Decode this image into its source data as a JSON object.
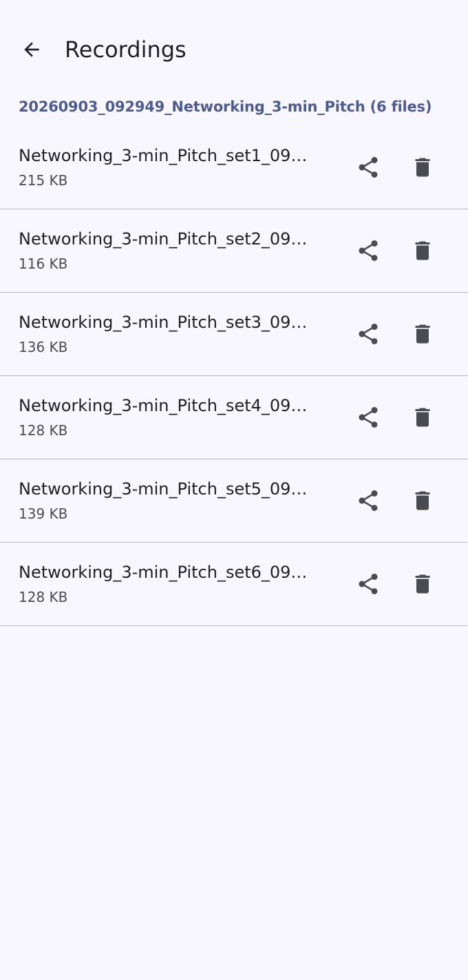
{
  "header": {
    "title": "Recordings",
    "back_icon": "arrow-left-icon"
  },
  "folder": {
    "label": "20260903_092949_Networking_3-min_Pitch (6 files)"
  },
  "files": [
    {
      "name": "Networking_3-min_Pitch_set1_09…",
      "size": "215 KB"
    },
    {
      "name": "Networking_3-min_Pitch_set2_09…",
      "size": "116 KB"
    },
    {
      "name": "Networking_3-min_Pitch_set3_09…",
      "size": "136 KB"
    },
    {
      "name": "Networking_3-min_Pitch_set4_09…",
      "size": "128 KB"
    },
    {
      "name": "Networking_3-min_Pitch_set5_09…",
      "size": "139 KB"
    },
    {
      "name": "Networking_3-min_Pitch_set6_09…",
      "size": "128 KB"
    }
  ],
  "icons": {
    "share": "share-icon",
    "delete": "trash-icon"
  },
  "colors": {
    "background": "#f9f7fe",
    "folder_header": "#4e5b8d",
    "icon": "#4a4a52",
    "divider": "#b7b5bb"
  }
}
